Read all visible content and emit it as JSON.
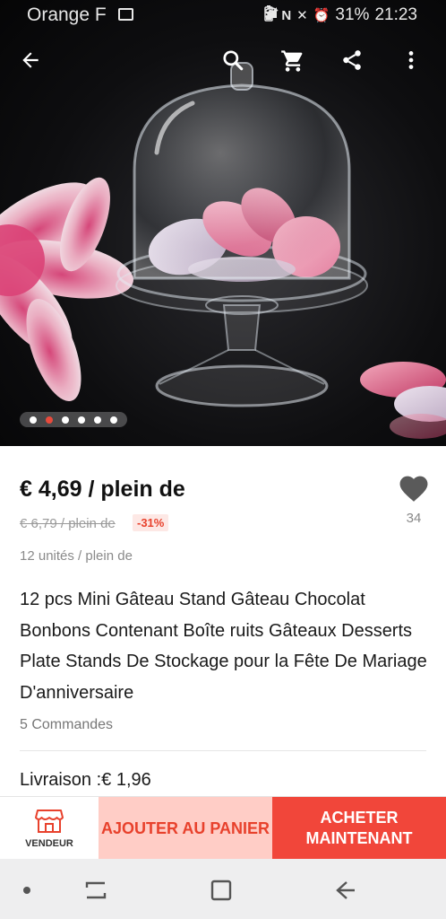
{
  "status_bar": {
    "carrier": "Orange F",
    "battery": "31%",
    "time": "21:23"
  },
  "app_bar": {
    "icons": [
      "back-arrow-icon",
      "search-icon",
      "cart-icon",
      "share-icon",
      "more-vert-icon"
    ]
  },
  "gallery": {
    "image_count": 6,
    "active_index": 1
  },
  "product": {
    "price": "€ 4,69 / plein de",
    "old_price": "€ 6,79 / plein de",
    "discount": "-31%",
    "units": "12 unités / plein de",
    "wishlist_count": "34",
    "title": "12 pcs Mini Gâteau Stand Gâteau Chocolat Bonbons Contenant Boîte ruits Gâteaux Desserts Plate Stands De Stockage pour la Fête De Mariage D'anniversaire",
    "orders": "5 Commandes",
    "shipping": "Livraison :€ 1,96"
  },
  "action_bar": {
    "seller_label": "VENDEUR",
    "add_to_cart": "AJOUTER AU PANIER",
    "buy_now": "ACHETER MAINTENANT"
  },
  "colors": {
    "accent_red": "#f1463a",
    "discount_red": "#e8412c",
    "cart_bg": "#ffcdc6",
    "active_dot": "#e84a3c"
  }
}
